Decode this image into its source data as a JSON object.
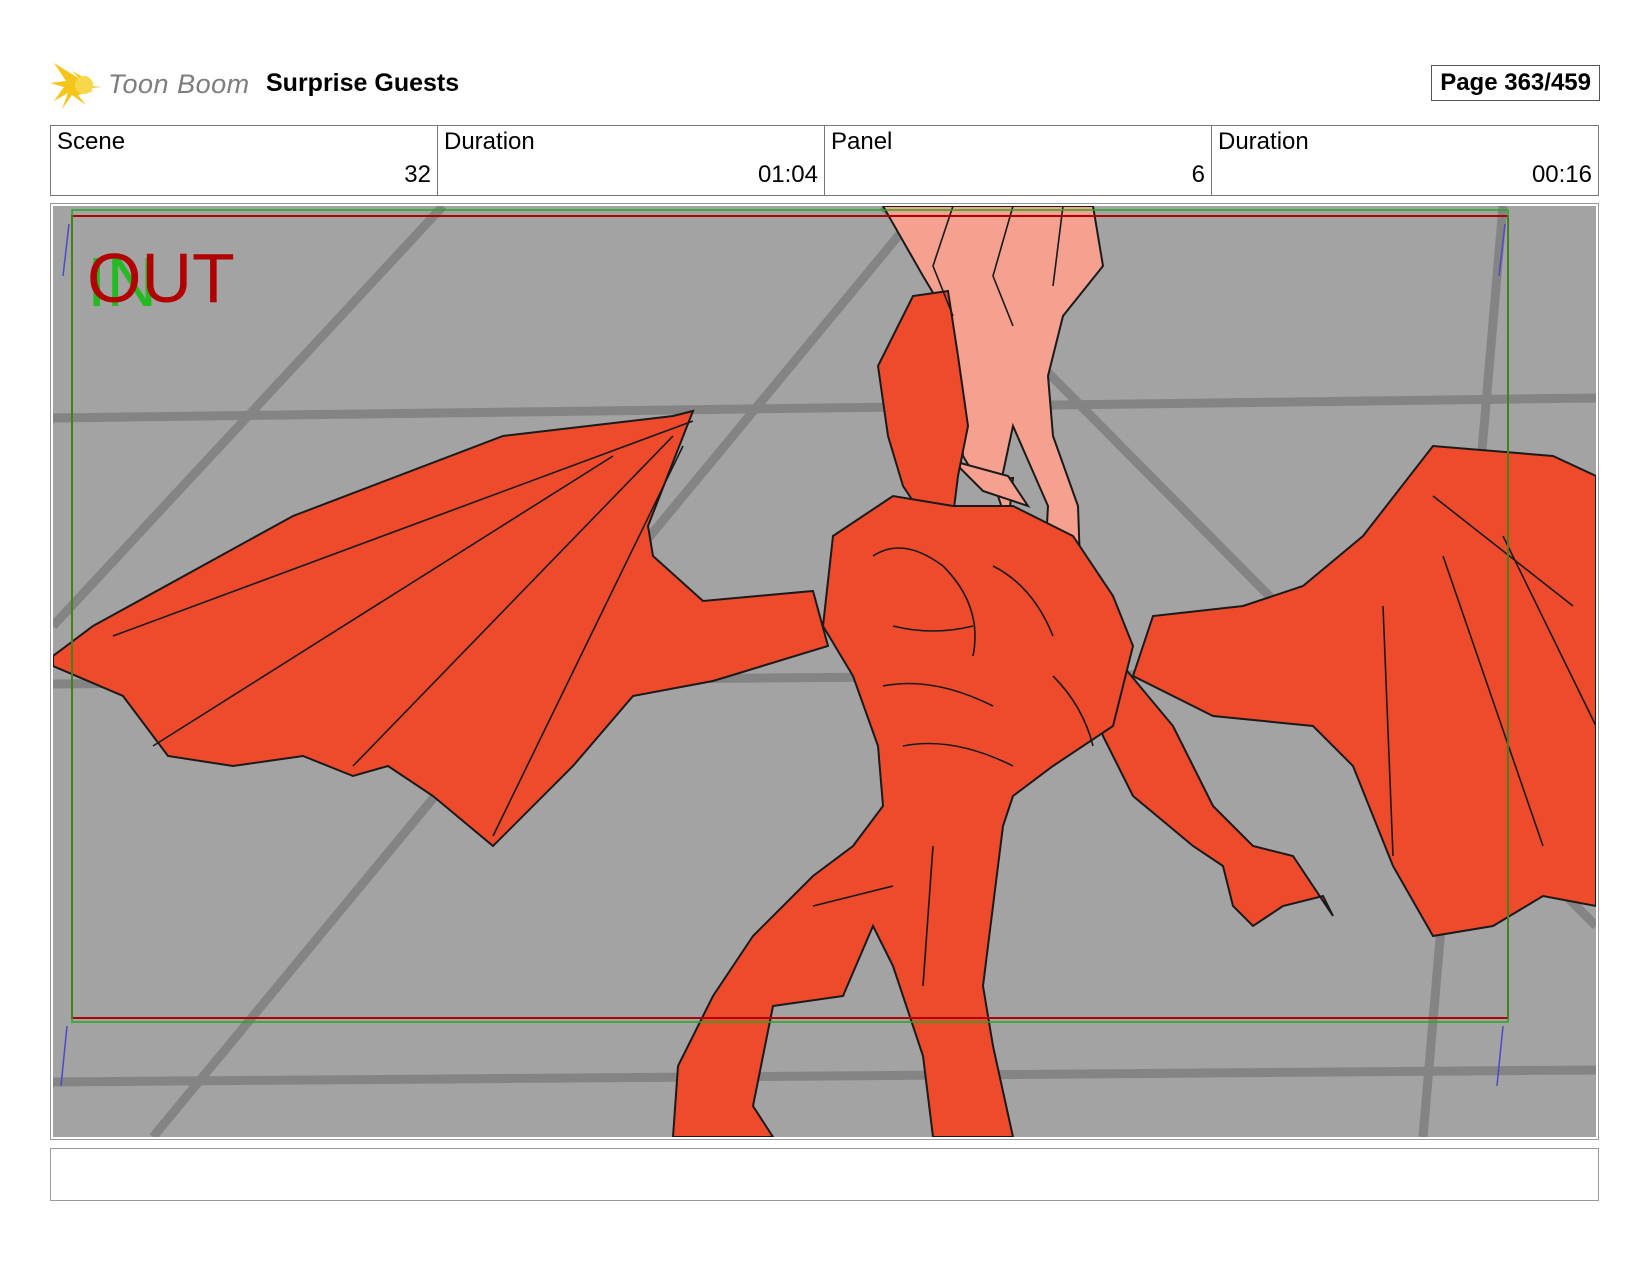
{
  "header": {
    "logo_text": "Toon Boom",
    "project_title": "Surprise Guests",
    "page": "Page 363/459"
  },
  "info": {
    "scene_label": "Scene",
    "scene_value": "32",
    "scene_duration_label": "Duration",
    "scene_duration_value": "01:04",
    "panel_label": "Panel",
    "panel_value": "6",
    "panel_duration_label": "Duration",
    "panel_duration_value": "00:16"
  },
  "panel": {
    "in_marker": "IN",
    "out_marker": "OUT",
    "colors": {
      "background": "#a3a3a3",
      "creature": "#ee4a2c",
      "human": "#f6a08f",
      "in_marker": "#22bb22",
      "out_marker": "#b00000"
    }
  },
  "caption": ""
}
